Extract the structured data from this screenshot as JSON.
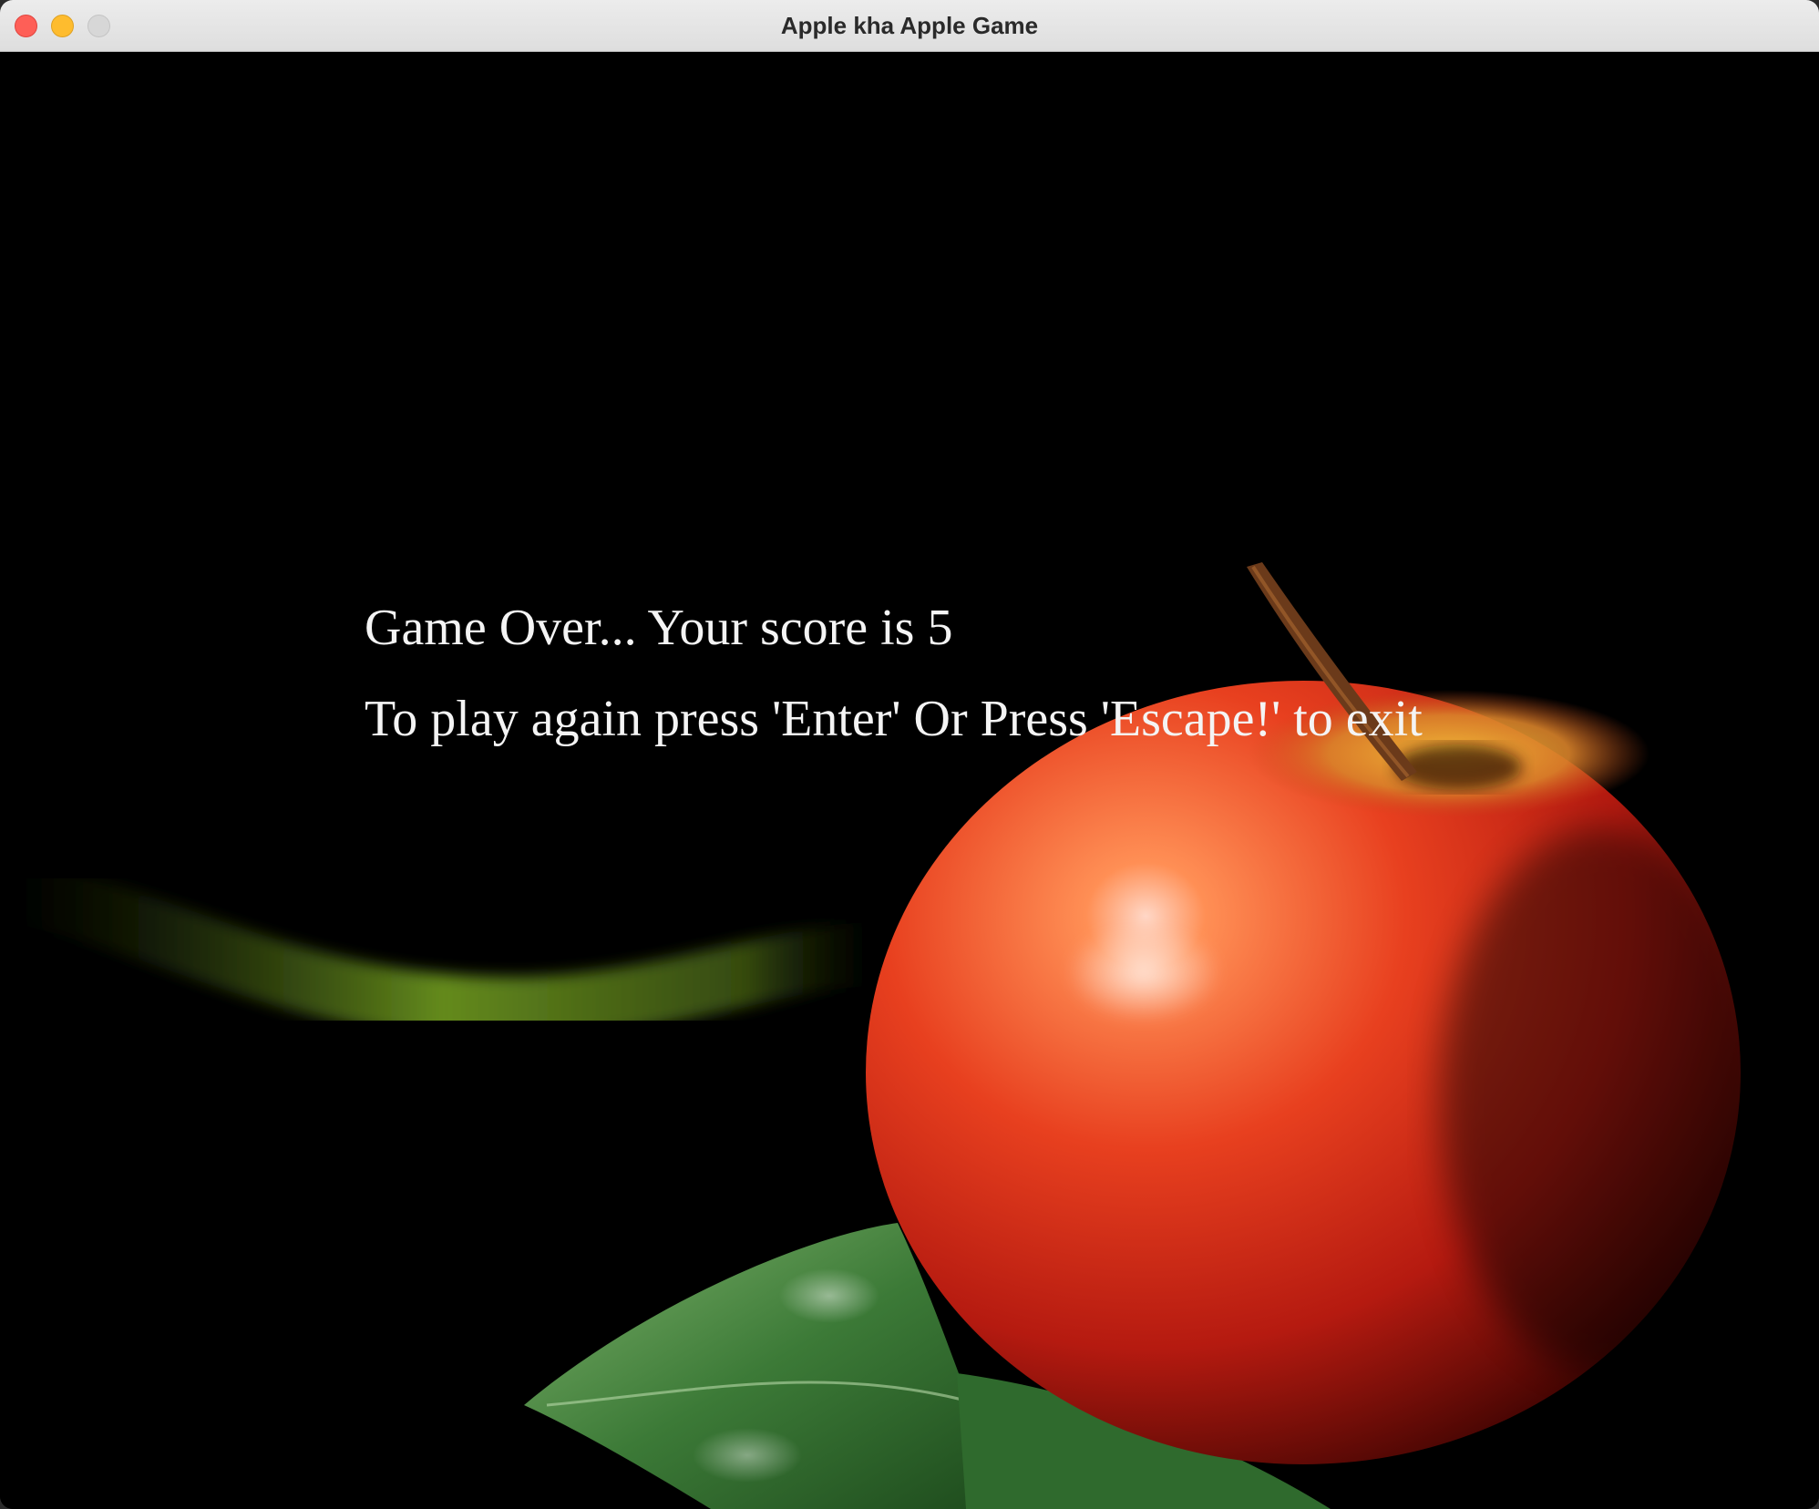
{
  "window": {
    "title": "Apple kha Apple Game"
  },
  "game": {
    "status_text": "Game Over... Your score is 5",
    "score": 5,
    "instruction_text": "To play again press 'Enter' Or Press 'Escape!' to exit"
  },
  "colors": {
    "background": "#000000",
    "apple_red": "#d1281a",
    "leaf_green": "#3f7a3a",
    "text": "#f4f4f4"
  },
  "icons": {
    "close": "close-button",
    "minimize": "minimize-button",
    "zoom": "zoom-button"
  }
}
